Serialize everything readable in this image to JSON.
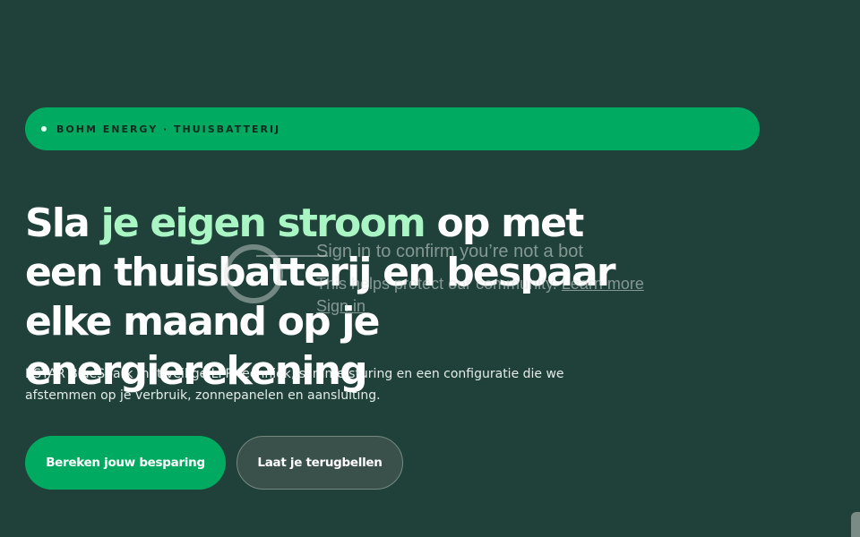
{
  "badge": {
    "text": "BOHM ENERGY · THUISBATTERIJ"
  },
  "hero": {
    "headline_part1": "Sla ",
    "headline_accent": "je eigen stroom",
    "headline_part2": " op met een thuisbatterij en bespaar elke maand op je energierekening",
    "intro": "KSTAR BlueSpark met veilige LFP-techniek, slimme sturing en een configuratie die we afstemmen op je verbruik, zonnepanelen en aansluiting.",
    "primary_button": "Bereken jouw besparing",
    "secondary_button": "Laat je terugbellen"
  },
  "bot_check": {
    "title": "Sign in to confirm you’re not a bot",
    "subtitle": "This helps protect our community.",
    "learn_more": "Learn more",
    "sign_in": "Sign in"
  },
  "colors": {
    "background": "#20413a",
    "accent_green": "#00ab61",
    "headline_accent": "#a9f5c4"
  }
}
